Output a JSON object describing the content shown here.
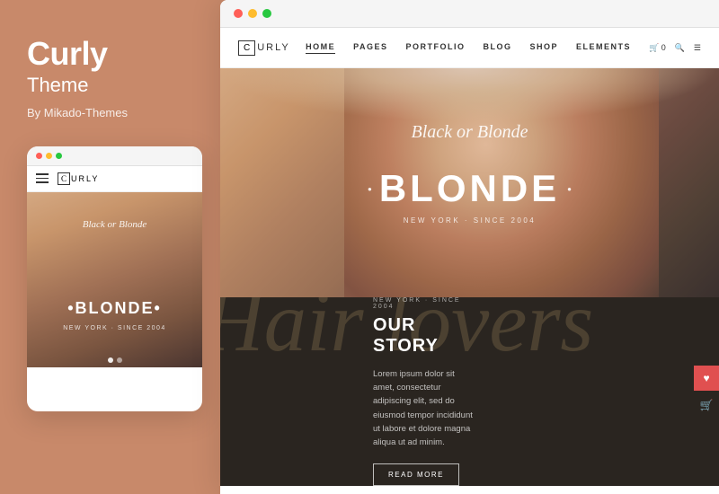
{
  "brand": {
    "title": "Curly",
    "subtitle": "Theme",
    "by_label": "By Mikado-Themes"
  },
  "mobile": {
    "logo_c": "C",
    "logo_rest": "URLY",
    "hero_script": "Black or Blonde",
    "hero_title": "•BLONDE•",
    "hero_sub": "NEW YORK · SINCE 2004",
    "indicator_count": 2
  },
  "desktop": {
    "logo_c": "C",
    "logo_text": "URLY",
    "nav_links": [
      "HOME",
      "PAGES",
      "PORTFOLIO",
      "BLOG",
      "SHOP",
      "ELEMENTS"
    ],
    "nav_active": "HOME",
    "cart_label": "0",
    "hero_script": "Black or Blonde",
    "hero_title": "BLONDE",
    "hero_sub": "NEW YORK · SINCE 2004",
    "dark_sub_label": "NEW YORK · SINCE 2004",
    "dark_title": "OUR STORY",
    "dark_body": "Lorem ipsum dolor sit amet, consectetur adipiscing elit, sed do eiusmod tempor incididunt ut labore et dolore magna aliqua ut ad minim.",
    "read_more_label": "READ MORE"
  },
  "dark_script_text": "Hair lovers",
  "colors": {
    "sidebar_bg": "#c8896a",
    "dark_section": "#2a2520",
    "accent_red": "#e05050"
  }
}
